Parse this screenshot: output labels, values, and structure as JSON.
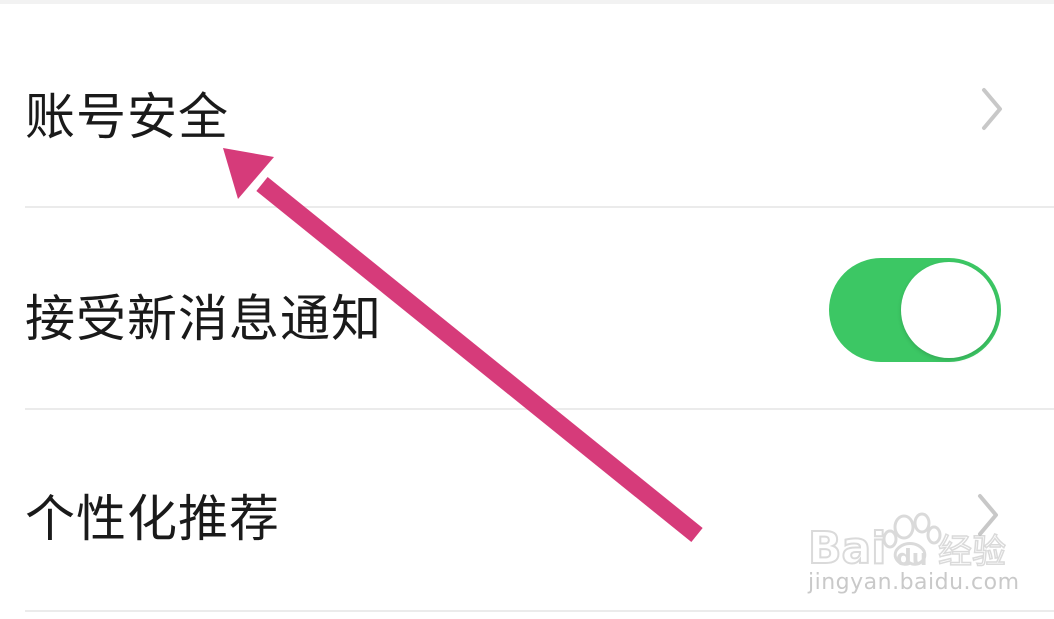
{
  "settings": {
    "items": [
      {
        "label": "账号安全",
        "type": "link"
      },
      {
        "label": "接受新消息通知",
        "type": "toggle",
        "toggle_on": true
      },
      {
        "label": "个性化推荐",
        "type": "link"
      }
    ]
  },
  "colors": {
    "toggle_on": "#3cc764",
    "annotation_arrow": "#d63b7a",
    "chevron": "#c8c8c8",
    "divider": "#ebebeb"
  },
  "icons": {
    "chevron": "chevron-right-icon",
    "arrow": "annotation-arrow-icon",
    "watermark": "baidu-jingyan-logo"
  },
  "watermark": {
    "logo_text": "Bai du 经验",
    "url": "jingyan.baidu.com"
  }
}
